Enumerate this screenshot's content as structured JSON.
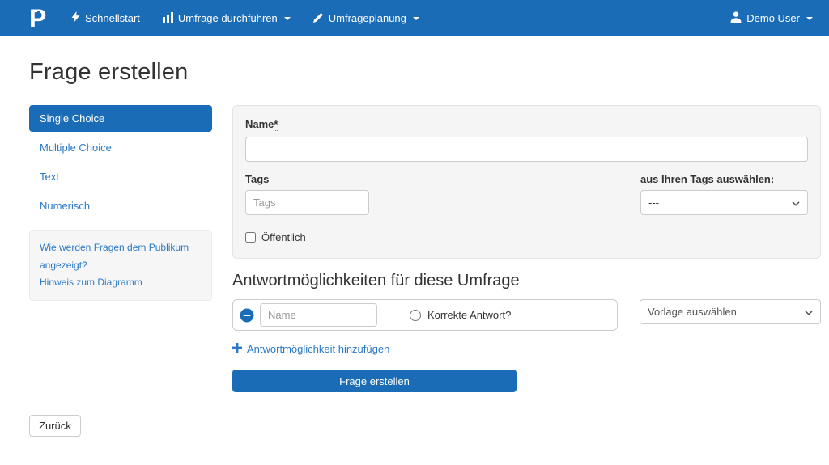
{
  "colors": {
    "primary": "#1b6cb7",
    "link": "#2a79c7",
    "panel_bg": "#f5f5f5"
  },
  "navbar": {
    "brand": "P",
    "items": [
      {
        "label": "Schnellstart",
        "icon": "lightning-icon",
        "has_dropdown": false
      },
      {
        "label": "Umfrage durchführen",
        "icon": "bar-chart-icon",
        "has_dropdown": true
      },
      {
        "label": "Umfrageplanung",
        "icon": "pencil-icon",
        "has_dropdown": true
      }
    ],
    "user": {
      "label": "Demo User",
      "icon": "user-icon",
      "has_dropdown": true
    }
  },
  "page": {
    "title": "Frage erstellen"
  },
  "sidebar": {
    "items": [
      {
        "label": "Single Choice",
        "active": true
      },
      {
        "label": "Multiple Choice",
        "active": false
      },
      {
        "label": "Text",
        "active": false
      },
      {
        "label": "Numerisch",
        "active": false
      }
    ],
    "help_links": [
      "Wie werden Fragen dem Publikum angezeigt?",
      "Hinweis zum Diagramm"
    ]
  },
  "form": {
    "name_label": "Name",
    "required_marker": "*",
    "name_value": "",
    "tags_label": "Tags",
    "tags_placeholder": "Tags",
    "tags_select_label": "aus Ihren Tags auswählen:",
    "tags_select_value": "---",
    "public_label": "Öffentlich"
  },
  "answers": {
    "section_title": "Antwortmöglichkeiten für diese Umfrage",
    "row": {
      "name_placeholder": "Name",
      "correct_label": "Korrekte Antwort?"
    },
    "template_select_value": "Vorlage auswählen",
    "add_link_label": "Antwortmöglichkeit hinzufügen",
    "submit_label": "Frage erstellen"
  },
  "footer": {
    "back_label": "Zurück"
  }
}
